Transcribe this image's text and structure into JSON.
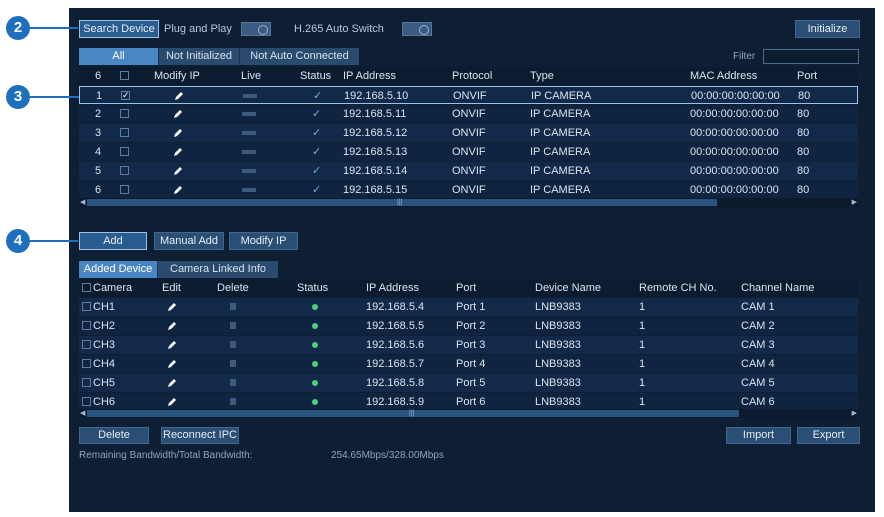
{
  "callouts": [
    "2",
    "3",
    "4"
  ],
  "toolbar": {
    "search_device": "Search Device",
    "plug_and_play": "Plug and Play",
    "h265_auto_switch": "H.265 Auto Switch",
    "initialize": "Initialize"
  },
  "search_tabs": [
    "All",
    "Not Initialized",
    "Not Auto Connected"
  ],
  "filter_label": "Filter",
  "search_table": {
    "headers": [
      "6",
      "",
      "Modify IP",
      "Live",
      "Status",
      "IP Address",
      "Protocol",
      "Type",
      "MAC Address",
      "Port"
    ],
    "rows": [
      {
        "no": "1",
        "checked": "✓",
        "ip": "192.168.5.10",
        "protocol": "ONVIF",
        "type": "IP CAMERA",
        "mac": "00:00:00:00:00:00",
        "port": "80"
      },
      {
        "no": "2",
        "checked": "",
        "ip": "192.168.5.11",
        "protocol": "ONVIF",
        "type": "IP CAMERA",
        "mac": "00:00:00:00:00:00",
        "port": "80"
      },
      {
        "no": "3",
        "checked": "",
        "ip": "192.168.5.12",
        "protocol": "ONVIF",
        "type": "IP CAMERA",
        "mac": "00:00:00:00:00:00",
        "port": "80"
      },
      {
        "no": "4",
        "checked": "",
        "ip": "192.168.5.13",
        "protocol": "ONVIF",
        "type": "IP CAMERA",
        "mac": "00:00:00:00:00:00",
        "port": "80"
      },
      {
        "no": "5",
        "checked": "",
        "ip": "192.168.5.14",
        "protocol": "ONVIF",
        "type": "IP CAMERA",
        "mac": "00:00:00:00:00:00",
        "port": "80"
      },
      {
        "no": "6",
        "checked": "",
        "ip": "192.168.5.15",
        "protocol": "ONVIF",
        "type": "IP CAMERA",
        "mac": "00:00:00:00:00:00",
        "port": "80"
      }
    ]
  },
  "add_buttons": {
    "add": "Add",
    "manual_add": "Manual Add",
    "modify_ip": "Modify IP"
  },
  "added_tabs": [
    "Added Device",
    "Camera Linked Info"
  ],
  "added_table": {
    "headers": [
      "Camera",
      "Edit",
      "Delete",
      "Status",
      "IP Address",
      "Port",
      "Device Name",
      "Remote CH No.",
      "Channel Name"
    ],
    "rows": [
      {
        "camera": "CH1",
        "ip": "192.168.5.4",
        "port": "Port 1",
        "device": "LNB9383",
        "remote": "1",
        "channel": "CAM 1"
      },
      {
        "camera": "CH2",
        "ip": "192.168.5.5",
        "port": "Port 2",
        "device": "LNB9383",
        "remote": "1",
        "channel": "CAM 2"
      },
      {
        "camera": "CH3",
        "ip": "192.168.5.6",
        "port": "Port 3",
        "device": "LNB9383",
        "remote": "1",
        "channel": "CAM 3"
      },
      {
        "camera": "CH4",
        "ip": "192.168.5.7",
        "port": "Port 4",
        "device": "LNB9383",
        "remote": "1",
        "channel": "CAM 4"
      },
      {
        "camera": "CH5",
        "ip": "192.168.5.8",
        "port": "Port 5",
        "device": "LNB9383",
        "remote": "1",
        "channel": "CAM 5"
      },
      {
        "camera": "CH6",
        "ip": "192.168.5.9",
        "port": "Port 6",
        "device": "LNB9383",
        "remote": "1",
        "channel": "CAM 6"
      }
    ]
  },
  "bottom": {
    "delete": "Delete",
    "reconnect_ipc": "Reconnect IPC",
    "import": "Import",
    "export": "Export",
    "bandwidth_label": "Remaining Bandwidth/Total Bandwidth:",
    "bandwidth_value": "254.65Mbps/328.00Mbps"
  },
  "colors": {
    "panel": "#0e1f33",
    "accent": "#4a86c2",
    "callout": "#1f6fbf",
    "status_online": "#4cd07a"
  }
}
